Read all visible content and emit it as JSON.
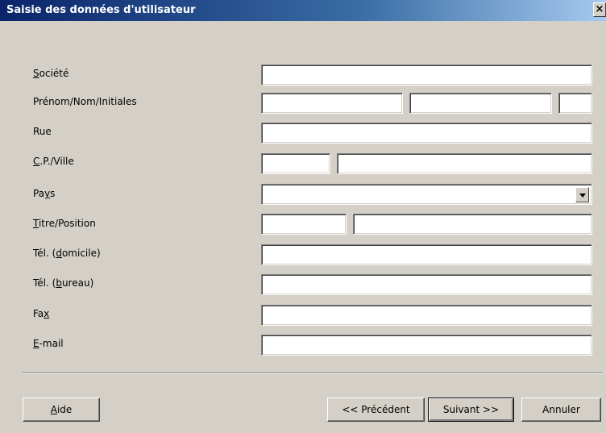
{
  "window": {
    "title": "Saisie des données d'utilisateur",
    "close_label": "×"
  },
  "form": {
    "societe": {
      "pre": "",
      "key": "S",
      "post": "ociété",
      "value": ""
    },
    "prenom_nom_initiales": {
      "label": "Prénom/Nom/Initiales",
      "prenom": "",
      "nom": "",
      "initiales": ""
    },
    "rue": {
      "label": "Rue",
      "value": ""
    },
    "cp_ville": {
      "pre": "",
      "key": "C",
      "post": ".P./Ville",
      "cp": "",
      "ville": ""
    },
    "pays": {
      "pre": "Pa",
      "key": "y",
      "post": "s",
      "value": ""
    },
    "titre_position": {
      "pre": "",
      "key": "T",
      "post": "itre/Position",
      "titre": "",
      "position": ""
    },
    "tel_domicile": {
      "pre": "Tél. (",
      "key": "d",
      "post": "omicile)",
      "value": ""
    },
    "tel_bureau": {
      "pre": "Tél. (",
      "key": "b",
      "post": "ureau)",
      "value": ""
    },
    "fax": {
      "pre": "Fa",
      "key": "x",
      "post": "",
      "value": ""
    },
    "email": {
      "pre": "",
      "key": "E",
      "post": "-mail",
      "value": ""
    }
  },
  "buttons": {
    "help": {
      "pre": "",
      "key": "A",
      "post": "ide"
    },
    "back": "<< Précédent",
    "next": "Suivant >>",
    "cancel": "Annuler"
  }
}
